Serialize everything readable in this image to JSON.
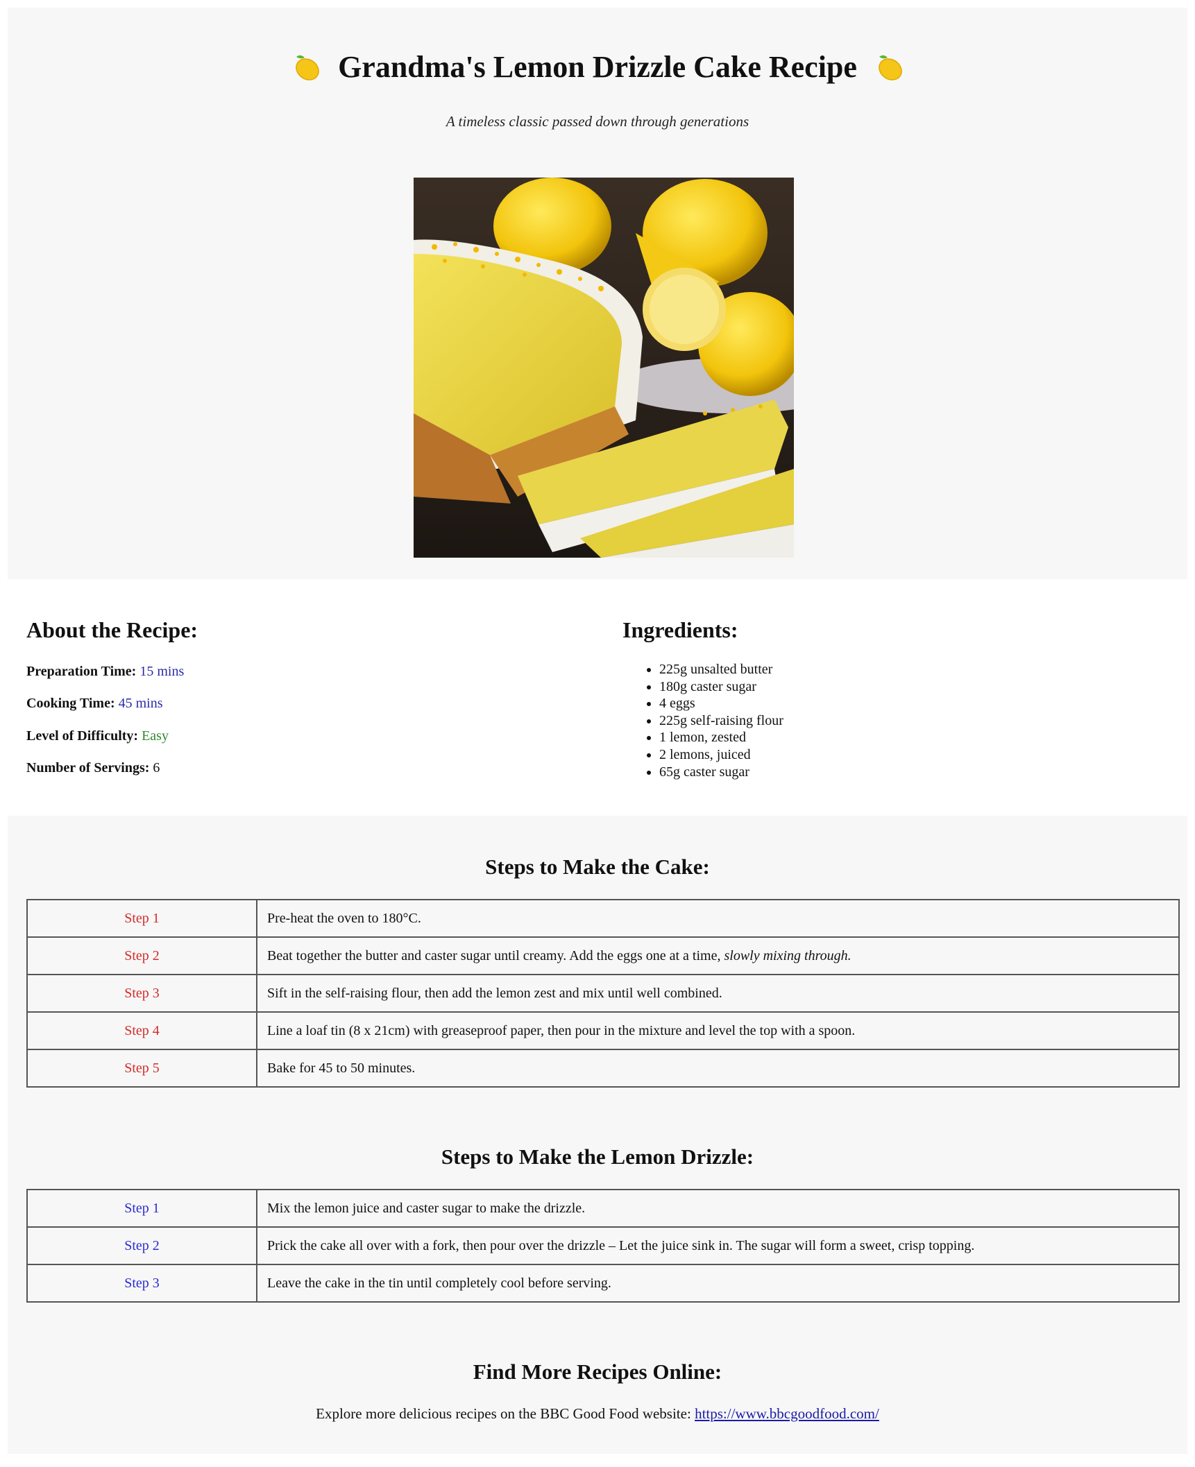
{
  "header": {
    "title": "Grandma's Lemon Drizzle Cake Recipe",
    "subtitle": "A timeless classic passed down through generations",
    "icon_left": "lemon-icon",
    "icon_right": "lemon-icon",
    "image_alt": "lemon-drizzle-cake-photo"
  },
  "about": {
    "heading": "About the Recipe:",
    "prep_label": "Preparation Time:",
    "prep_value": "15 mins",
    "cook_label": "Cooking Time:",
    "cook_value": "45 mins",
    "difficulty_label": "Level of Difficulty:",
    "difficulty_value": "Easy",
    "servings_label": "Number of Servings:",
    "servings_value": "6"
  },
  "ingredients": {
    "heading": "Ingredients:",
    "items": [
      "225g unsalted butter",
      "180g caster sugar",
      "4 eggs",
      "225g self-raising flour",
      "1 lemon, zested",
      "2 lemons, juiced",
      "65g caster sugar"
    ]
  },
  "cake_steps": {
    "heading": "Steps to Make the Cake:",
    "rows": [
      {
        "label": "Step 1",
        "text": "Pre-heat the oven to 180°C."
      },
      {
        "label": "Step 2",
        "text": "Beat together the butter and caster sugar until creamy. Add the eggs one at a time, ",
        "emphasis": "slowly mixing through."
      },
      {
        "label": "Step 3",
        "text": "Sift in the self-raising flour, then add the lemon zest and mix until well combined."
      },
      {
        "label": "Step 4",
        "text": "Line a loaf tin (8 x 21cm) with greaseproof paper, then pour in the mixture and level the top with a spoon."
      },
      {
        "label": "Step 5",
        "text": "Bake for 45 to 50 minutes."
      }
    ]
  },
  "drizzle_steps": {
    "heading": "Steps to Make the Lemon Drizzle:",
    "rows": [
      {
        "label": "Step 1",
        "text": "Mix the lemon juice and caster sugar to make the drizzle."
      },
      {
        "label": "Step 2",
        "text": "Prick the cake all over with a fork, then pour over the drizzle – Let the juice sink in. The sugar will form a sweet, crisp topping."
      },
      {
        "label": "Step 3",
        "text": "Leave the cake in the tin until completely cool before serving."
      }
    ]
  },
  "footer": {
    "heading": "Find More Recipes Online:",
    "text": "Explore more delicious recipes on the BBC Good Food website: ",
    "link_text": "https://www.bbcgoodfood.com/"
  },
  "colors": {
    "panel_bg": "#f7f7f7",
    "cake_step_label": "#d42a2a",
    "drizzle_step_label": "#2a2ad0",
    "time_value": "#2a2aa8",
    "difficulty_value": "#2f8a2f"
  }
}
